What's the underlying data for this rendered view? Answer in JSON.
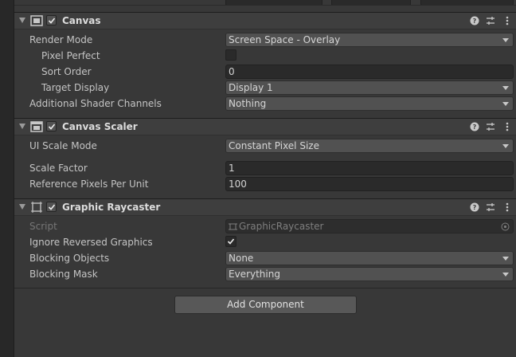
{
  "canvas": {
    "title": "Canvas",
    "enabled": true,
    "properties": [
      {
        "label": "Render Mode",
        "value": "Screen Space - Overlay"
      },
      {
        "label": "Pixel Perfect",
        "value": false
      },
      {
        "label": "Sort Order",
        "value": "0"
      },
      {
        "label": "Target Display",
        "value": "Display 1"
      },
      {
        "label": "Additional Shader Channels",
        "value": "Nothing"
      }
    ]
  },
  "canvas_scaler": {
    "title": "Canvas Scaler",
    "enabled": true,
    "properties": [
      {
        "label": "UI Scale Mode",
        "value": "Constant Pixel Size"
      },
      {
        "label": "Scale Factor",
        "value": "1"
      },
      {
        "label": "Reference Pixels Per Unit",
        "value": "100"
      }
    ]
  },
  "graphic_raycaster": {
    "title": "Graphic Raycaster",
    "enabled": true,
    "properties": [
      {
        "label": "Script",
        "value": "GraphicRaycaster"
      },
      {
        "label": "Ignore Reversed Graphics",
        "value": true
      },
      {
        "label": "Blocking Objects",
        "value": "None"
      },
      {
        "label": "Blocking Mask",
        "value": "Everything"
      }
    ]
  },
  "add_component_label": "Add Component",
  "icons": {
    "help": "help-icon",
    "presets": "presets-icon",
    "menu": "kebab-menu-icon"
  },
  "colors": {
    "background": "#383838",
    "header": "#3e3e3e",
    "text": "#c4c4c4"
  }
}
